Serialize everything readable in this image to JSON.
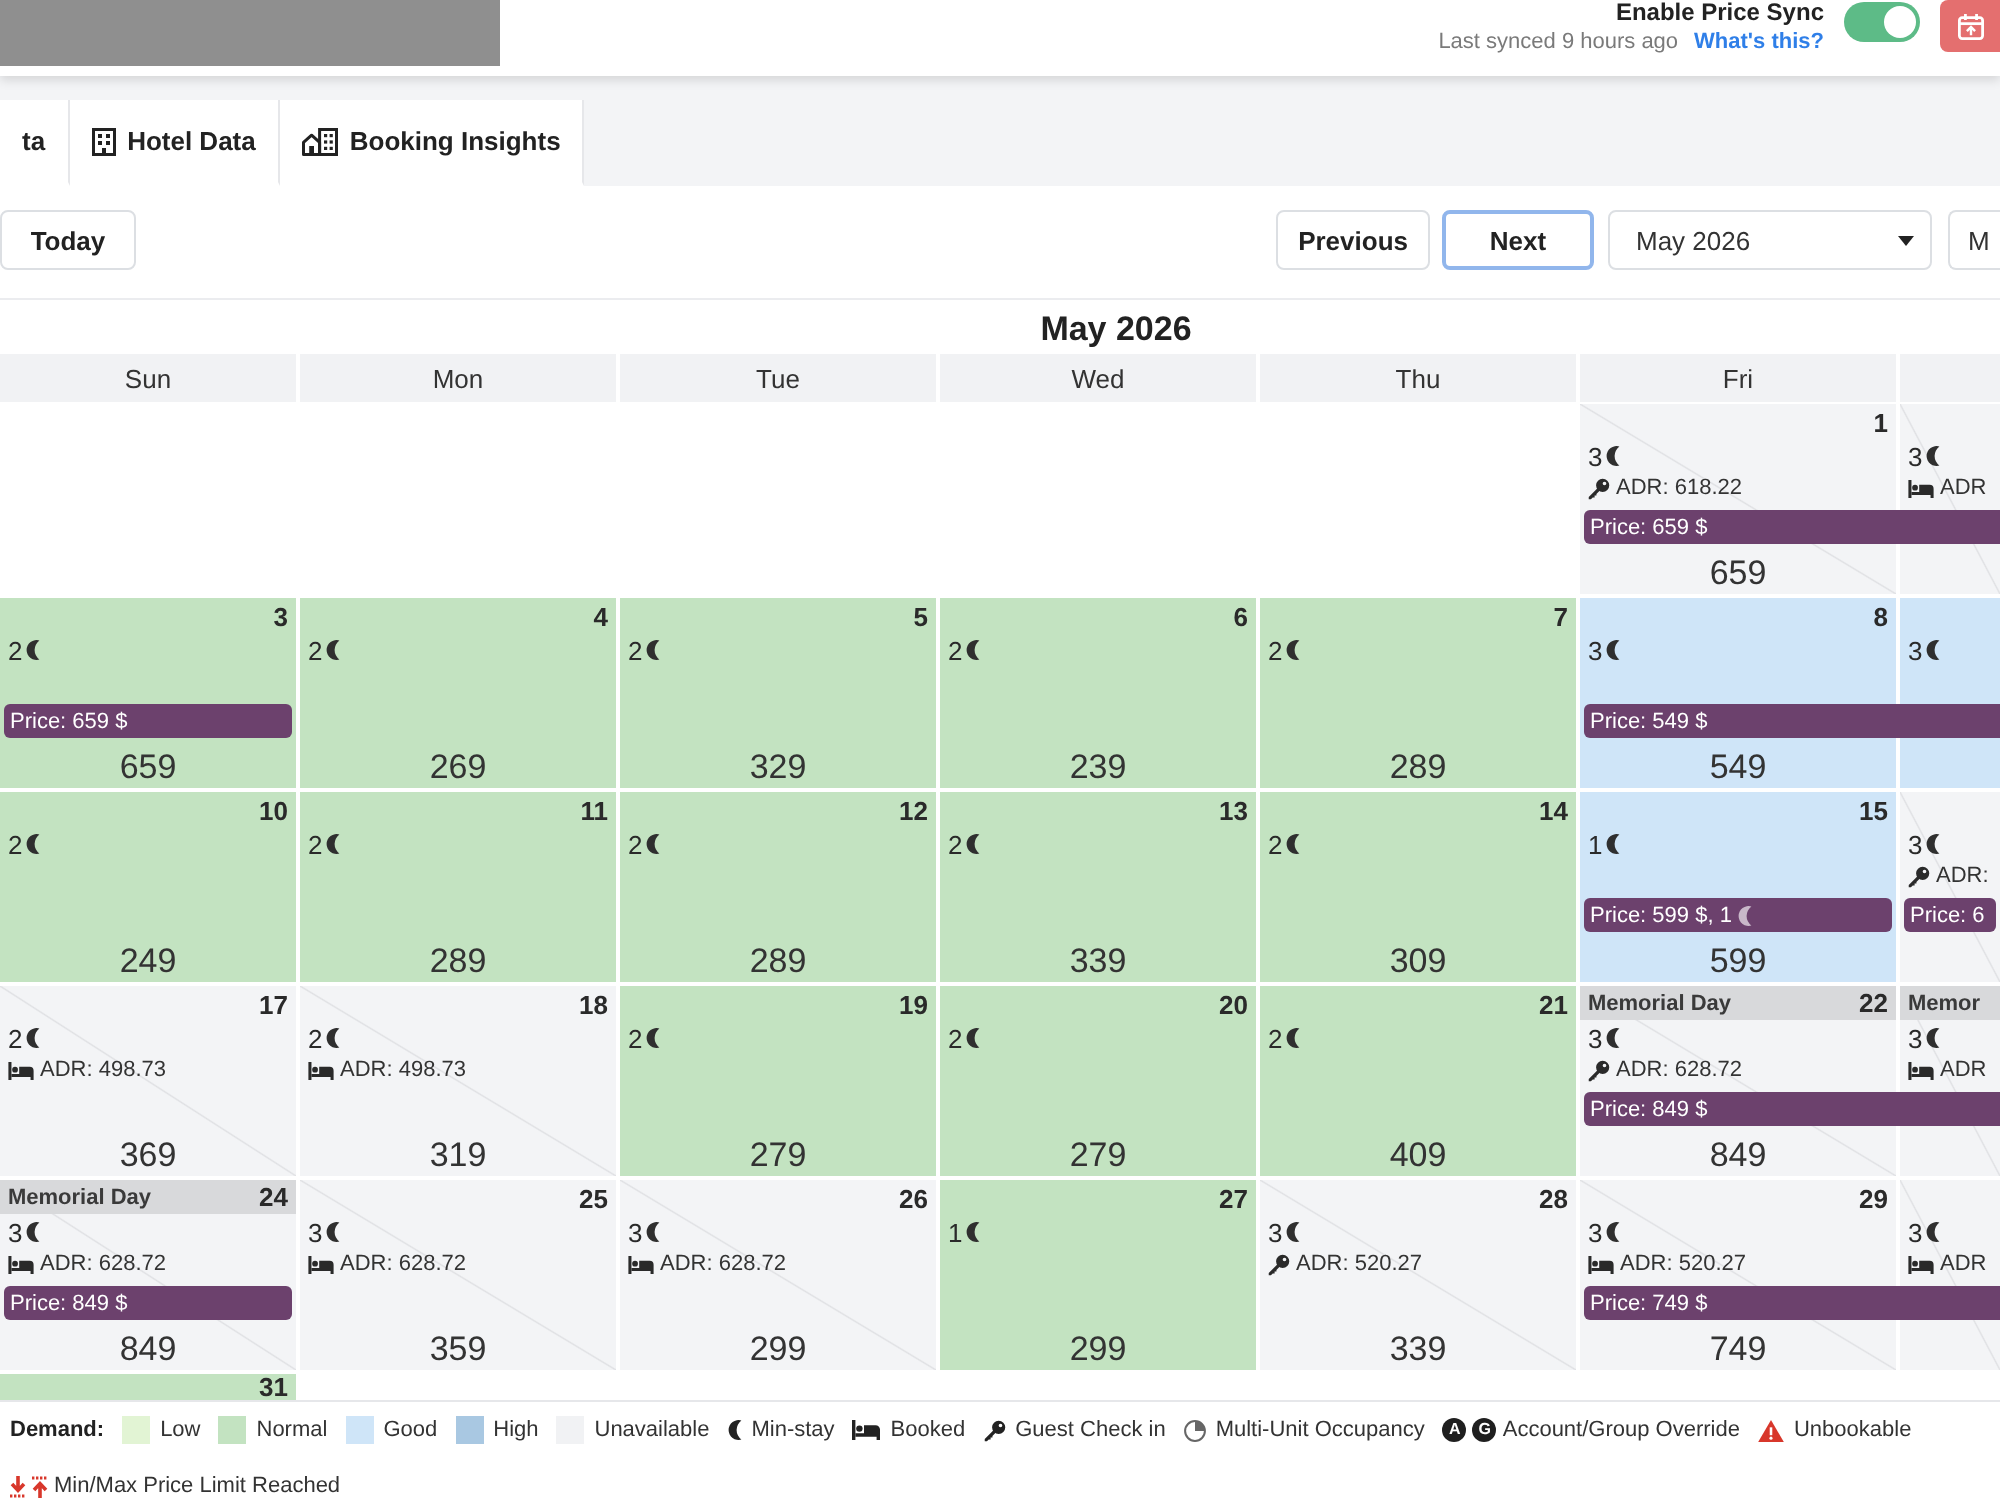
{
  "header": {
    "sync_label": "Enable Price Sync",
    "last_synced": "Last synced 9 hours ago",
    "help_link": "What's this?",
    "sync_on": true
  },
  "tabs": [
    {
      "label": "ta",
      "kind": "plain",
      "selected": false
    },
    {
      "label": "Hotel Data",
      "kind": "hotel",
      "selected": false
    },
    {
      "label": "Booking Insights",
      "kind": "insights",
      "selected": false
    }
  ],
  "toolbar": {
    "today": "Today",
    "nav_buttons": [
      {
        "label": "Previous",
        "focused": false
      },
      {
        "label": "Next",
        "focused": true
      }
    ],
    "month_select": "May 2026",
    "view_select": "M"
  },
  "calendar": {
    "title": "May 2026",
    "weekdays": [
      "Sun",
      "Mon",
      "Tue",
      "Wed",
      "Thu",
      "Fri"
    ],
    "weeks": [
      {
        "days": [
          {
            "kind": "blank"
          },
          {
            "kind": "blank"
          },
          {
            "kind": "blank"
          },
          {
            "kind": "blank"
          },
          {
            "kind": "blank"
          },
          {
            "kind": "day",
            "color": "#f3f4f6",
            "unavailable": true,
            "date": "1",
            "min_stay": "3",
            "adr": {
              "kind": "check_in",
              "text": "ADR: 618.22"
            },
            "price_bar": {
              "label": "Price: 659 $",
              "continues": true
            },
            "price": "659"
          },
          {
            "kind": "day",
            "color": "#f3f4f6",
            "unavailable": true,
            "min_stay": "3",
            "adr": {
              "kind": "booked",
              "text": "ADR"
            }
          }
        ]
      },
      {
        "days": [
          {
            "kind": "day",
            "color": "#c3e3c1",
            "unavailable": false,
            "date": "3",
            "min_stay": "2",
            "price_bar": {
              "label": "Price: 659 $",
              "continues": false
            },
            "price": "659"
          },
          {
            "kind": "day",
            "color": "#c3e3c1",
            "unavailable": false,
            "date": "4",
            "min_stay": "2",
            "price": "269"
          },
          {
            "kind": "day",
            "color": "#c3e3c1",
            "unavailable": false,
            "date": "5",
            "min_stay": "2",
            "price": "329"
          },
          {
            "kind": "day",
            "color": "#c3e3c1",
            "unavailable": false,
            "date": "6",
            "min_stay": "2",
            "price": "239"
          },
          {
            "kind": "day",
            "color": "#c3e3c1",
            "unavailable": false,
            "date": "7",
            "min_stay": "2",
            "price": "289"
          },
          {
            "kind": "day",
            "color": "#cfe5f8",
            "unavailable": false,
            "date": "8",
            "min_stay": "3",
            "price_bar": {
              "label": "Price: 549 $",
              "continues": true
            },
            "price": "549"
          },
          {
            "kind": "day",
            "color": "#cfe5f8",
            "unavailable": false,
            "min_stay": "3"
          }
        ]
      },
      {
        "days": [
          {
            "kind": "day",
            "color": "#c3e3c1",
            "unavailable": false,
            "date": "10",
            "min_stay": "2",
            "price": "249"
          },
          {
            "kind": "day",
            "color": "#c3e3c1",
            "unavailable": false,
            "date": "11",
            "min_stay": "2",
            "price": "289"
          },
          {
            "kind": "day",
            "color": "#c3e3c1",
            "unavailable": false,
            "date": "12",
            "min_stay": "2",
            "price": "289"
          },
          {
            "kind": "day",
            "color": "#c3e3c1",
            "unavailable": false,
            "date": "13",
            "min_stay": "2",
            "price": "339"
          },
          {
            "kind": "day",
            "color": "#c3e3c1",
            "unavailable": false,
            "date": "14",
            "min_stay": "2",
            "price": "309"
          },
          {
            "kind": "day",
            "color": "#cfe5f8",
            "unavailable": false,
            "date": "15",
            "min_stay": "1",
            "price_bar": {
              "label": "Price: 599 $,",
              "min_stay": "1",
              "continues": false
            },
            "price": "599"
          },
          {
            "kind": "day",
            "color": "#f3f4f6",
            "unavailable": true,
            "min_stay": "3",
            "adr": {
              "kind": "check_in",
              "text": "ADR:"
            },
            "price_bar": {
              "label": "Price: 6",
              "continues": false
            }
          }
        ]
      },
      {
        "days": [
          {
            "kind": "day",
            "color": "#f3f4f6",
            "unavailable": true,
            "date": "17",
            "min_stay": "2",
            "adr": {
              "kind": "booked",
              "text": "ADR: 498.73"
            },
            "price": "369"
          },
          {
            "kind": "day",
            "color": "#f3f4f6",
            "unavailable": true,
            "date": "18",
            "min_stay": "2",
            "adr": {
              "kind": "booked",
              "text": "ADR: 498.73"
            },
            "price": "319"
          },
          {
            "kind": "day",
            "color": "#c3e3c1",
            "unavailable": false,
            "date": "19",
            "min_stay": "2",
            "price": "279"
          },
          {
            "kind": "day",
            "color": "#c3e3c1",
            "unavailable": false,
            "date": "20",
            "min_stay": "2",
            "price": "279"
          },
          {
            "kind": "day",
            "color": "#c3e3c1",
            "unavailable": false,
            "date": "21",
            "min_stay": "2",
            "price": "409"
          },
          {
            "kind": "day",
            "color": "#f3f4f6",
            "unavailable": true,
            "holiday": "Memorial Day",
            "date": "22",
            "min_stay": "3",
            "adr": {
              "kind": "check_in",
              "text": "ADR: 628.72"
            },
            "price_bar": {
              "label": "Price: 849 $",
              "continues": true
            },
            "price": "849"
          },
          {
            "kind": "day",
            "color": "#f3f4f6",
            "unavailable": true,
            "holiday": "Memor",
            "min_stay": "3",
            "adr": {
              "kind": "booked",
              "text": "ADR"
            }
          }
        ]
      },
      {
        "days": [
          {
            "kind": "day",
            "color": "#f3f4f6",
            "unavailable": true,
            "holiday": "Memorial Day",
            "date": "24",
            "min_stay": "3",
            "adr": {
              "kind": "booked",
              "text": "ADR: 628.72"
            },
            "price_bar": {
              "label": "Price: 849 $",
              "continues": false
            },
            "price": "849"
          },
          {
            "kind": "day",
            "color": "#f3f4f6",
            "unavailable": true,
            "date": "25",
            "min_stay": "3",
            "adr": {
              "kind": "booked",
              "text": "ADR: 628.72"
            },
            "price": "359"
          },
          {
            "kind": "day",
            "color": "#f3f4f6",
            "unavailable": true,
            "date": "26",
            "min_stay": "3",
            "adr": {
              "kind": "booked",
              "text": "ADR: 628.72"
            },
            "price": "299"
          },
          {
            "kind": "day",
            "color": "#c3e3c1",
            "unavailable": false,
            "date": "27",
            "min_stay": "1",
            "price": "299"
          },
          {
            "kind": "day",
            "color": "#f3f4f6",
            "unavailable": true,
            "date": "28",
            "min_stay": "3",
            "adr": {
              "kind": "check_in",
              "text": "ADR: 520.27"
            },
            "price": "339"
          },
          {
            "kind": "day",
            "color": "#f3f4f6",
            "unavailable": true,
            "date": "29",
            "min_stay": "3",
            "adr": {
              "kind": "booked",
              "text": "ADR: 520.27"
            },
            "price_bar": {
              "label": "Price: 749 $",
              "continues": true
            },
            "price": "749"
          },
          {
            "kind": "day",
            "color": "#f3f4f6",
            "unavailable": true,
            "min_stay": "3",
            "adr": {
              "kind": "booked",
              "text": "ADR"
            }
          }
        ]
      },
      {
        "days": [
          {
            "kind": "day",
            "color": "#c3e3c1",
            "unavailable": false,
            "date": "31"
          },
          {
            "kind": "blank"
          },
          {
            "kind": "blank"
          },
          {
            "kind": "blank"
          },
          {
            "kind": "blank"
          },
          {
            "kind": "blank"
          },
          {
            "kind": "blank"
          }
        ]
      }
    ]
  },
  "legend": {
    "title": "Demand:",
    "items": [
      {
        "kind": "swatch",
        "label": "Low",
        "color": "#e2f4d4"
      },
      {
        "kind": "swatch",
        "label": "Normal",
        "color": "#c3e3c1"
      },
      {
        "kind": "swatch",
        "label": "Good",
        "color": "#cfe5f8"
      },
      {
        "kind": "swatch",
        "label": "High",
        "color": "#a9c8e2"
      },
      {
        "kind": "swatch",
        "label": "Unavailable",
        "color": "#f1f2f4"
      },
      {
        "kind": "min_stay",
        "label": "Min-stay"
      },
      {
        "kind": "booked",
        "label": "Booked"
      },
      {
        "kind": "check_in",
        "label": "Guest Check in"
      },
      {
        "kind": "multi_unit",
        "label": "Multi-Unit Occupancy"
      },
      {
        "kind": "override",
        "label": "Account/Group Override",
        "badges": [
          "A",
          "G"
        ]
      },
      {
        "kind": "unbookable",
        "label": "Unbookable"
      },
      {
        "kind": "price_limit",
        "label": "Min/Max Price Limit Reached"
      }
    ]
  }
}
